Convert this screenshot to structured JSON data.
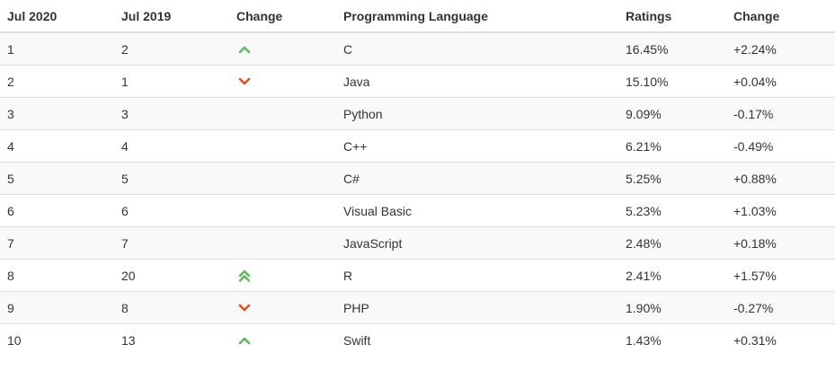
{
  "header": {
    "col1": "Jul 2020",
    "col2": "Jul 2019",
    "col3": "Change",
    "col4": "Programming Language",
    "col5": "Ratings",
    "col6": "Change"
  },
  "colors": {
    "up": "#5cb85c",
    "down": "#d9531e"
  },
  "rows": [
    {
      "rank2020": "1",
      "rank2019": "2",
      "trend": "up-icon",
      "language": "C",
      "rating": "16.45%",
      "change": "+2.24%"
    },
    {
      "rank2020": "2",
      "rank2019": "1",
      "trend": "down-icon",
      "language": "Java",
      "rating": "15.10%",
      "change": "+0.04%"
    },
    {
      "rank2020": "3",
      "rank2019": "3",
      "trend": "",
      "language": "Python",
      "rating": "9.09%",
      "change": "-0.17%"
    },
    {
      "rank2020": "4",
      "rank2019": "4",
      "trend": "",
      "language": "C++",
      "rating": "6.21%",
      "change": "-0.49%"
    },
    {
      "rank2020": "5",
      "rank2019": "5",
      "trend": "",
      "language": "C#",
      "rating": "5.25%",
      "change": "+0.88%"
    },
    {
      "rank2020": "6",
      "rank2019": "6",
      "trend": "",
      "language": "Visual Basic",
      "rating": "5.23%",
      "change": "+1.03%"
    },
    {
      "rank2020": "7",
      "rank2019": "7",
      "trend": "",
      "language": "JavaScript",
      "rating": "2.48%",
      "change": "+0.18%"
    },
    {
      "rank2020": "8",
      "rank2019": "20",
      "trend": "double-up-icon",
      "language": "R",
      "rating": "2.41%",
      "change": "+1.57%"
    },
    {
      "rank2020": "9",
      "rank2019": "8",
      "trend": "down-icon",
      "language": "PHP",
      "rating": "1.90%",
      "change": "-0.27%"
    },
    {
      "rank2020": "10",
      "rank2019": "13",
      "trend": "up-icon",
      "language": "Swift",
      "rating": "1.43%",
      "change": "+0.31%"
    }
  ]
}
